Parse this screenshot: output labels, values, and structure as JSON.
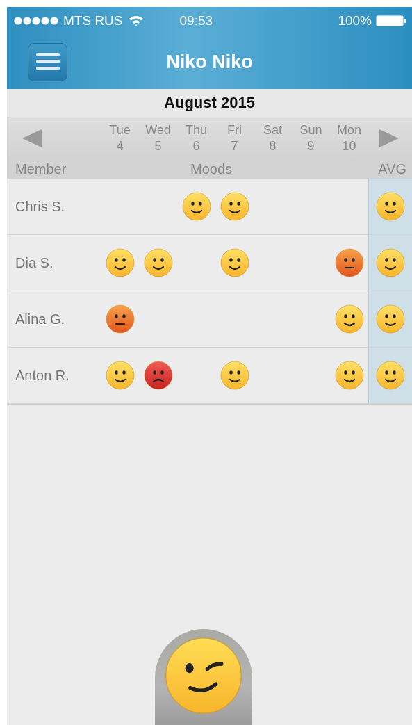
{
  "status_bar": {
    "carrier": "MTS RUS",
    "time": "09:53",
    "battery": "100%"
  },
  "nav": {
    "title": "Niko Niko"
  },
  "calendar": {
    "month": "August 2015",
    "days": [
      {
        "weekday": "Tue",
        "date": "4"
      },
      {
        "weekday": "Wed",
        "date": "5"
      },
      {
        "weekday": "Thu",
        "date": "6"
      },
      {
        "weekday": "Fri",
        "date": "7"
      },
      {
        "weekday": "Sat",
        "date": "8"
      },
      {
        "weekday": "Sun",
        "date": "9"
      },
      {
        "weekday": "Mon",
        "date": "10"
      }
    ],
    "headers": {
      "member": "Member",
      "moods": "Moods",
      "avg": "AVG"
    }
  },
  "rows": [
    {
      "member": "Chris S.",
      "moods": [
        {
          "kind": "empty"
        },
        {
          "kind": "empty"
        },
        {
          "kind": "happy"
        },
        {
          "kind": "happy"
        },
        {
          "kind": "empty"
        },
        {
          "kind": "empty"
        },
        {
          "kind": "empty"
        }
      ],
      "avg": {
        "kind": "happy"
      }
    },
    {
      "member": "Dia S.",
      "moods": [
        {
          "kind": "happy"
        },
        {
          "kind": "happy"
        },
        {
          "kind": "empty"
        },
        {
          "kind": "happy"
        },
        {
          "kind": "empty"
        },
        {
          "kind": "empty"
        },
        {
          "kind": "neutral"
        }
      ],
      "avg": {
        "kind": "happy"
      }
    },
    {
      "member": "Alina G.",
      "moods": [
        {
          "kind": "neutral"
        },
        {
          "kind": "empty"
        },
        {
          "kind": "empty"
        },
        {
          "kind": "empty"
        },
        {
          "kind": "empty"
        },
        {
          "kind": "empty"
        },
        {
          "kind": "happy"
        }
      ],
      "avg": {
        "kind": "happy"
      }
    },
    {
      "member": "Anton R.",
      "moods": [
        {
          "kind": "happy"
        },
        {
          "kind": "sad"
        },
        {
          "kind": "empty"
        },
        {
          "kind": "happy"
        },
        {
          "kind": "empty"
        },
        {
          "kind": "empty"
        },
        {
          "kind": "happy"
        }
      ],
      "avg": {
        "kind": "happy"
      }
    }
  ],
  "mood_button": {
    "kind": "wink"
  }
}
